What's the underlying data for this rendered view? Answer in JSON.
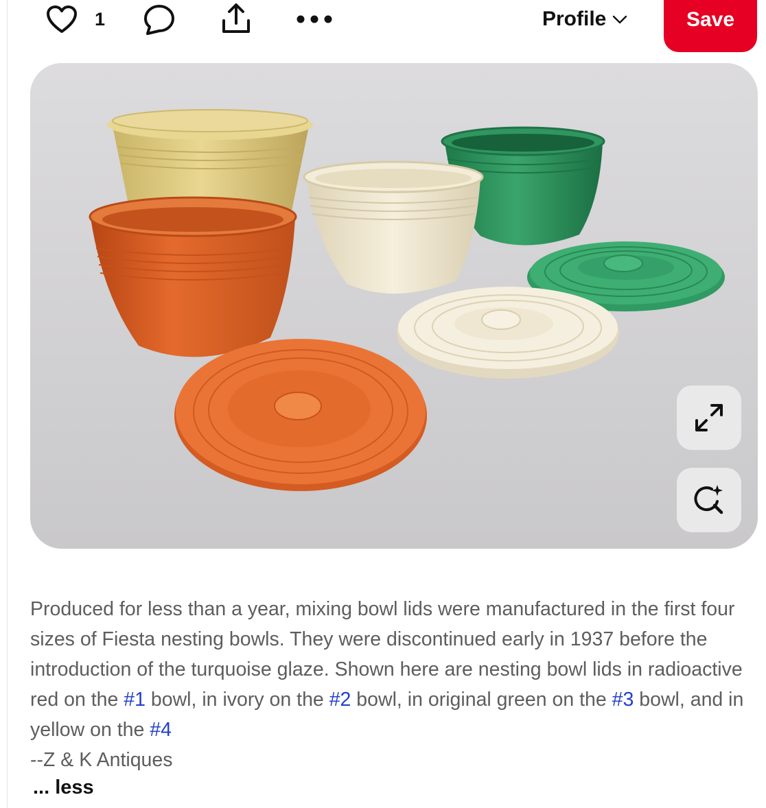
{
  "toolbar": {
    "like_icon": "heart-outline-icon",
    "like_count": "1",
    "comment_icon": "speech-bubble-icon",
    "share_icon": "share-upload-icon",
    "more_icon": "more-dots-icon",
    "profile_label": "Profile",
    "profile_chevron_icon": "chevron-down-icon",
    "save_label": "Save",
    "save_color": "#e60023"
  },
  "pin_image": {
    "expand_icon": "expand-arrows-icon",
    "visual_search_icon": "lens-sparkle-icon"
  },
  "description": {
    "text_1": "Produced for less than a year, mixing bowl lids were manufactured in the first four sizes of Fiesta nesting bowls. They were discontinued early in 1937 before the introduction of the turquoise glaze. Shown here are nesting bowl lids in radioactive red on the ",
    "tag_1": "#1",
    "text_2": " bowl, in ivory on the ",
    "tag_2": "#2",
    "text_3": " bowl, in original green on the ",
    "tag_3": "#3",
    "text_4": " bowl, and in yellow on the ",
    "tag_4": "#4",
    "credit": "--Z & K Antiques",
    "less_label": "... less",
    "link_color": "#2340c9"
  }
}
